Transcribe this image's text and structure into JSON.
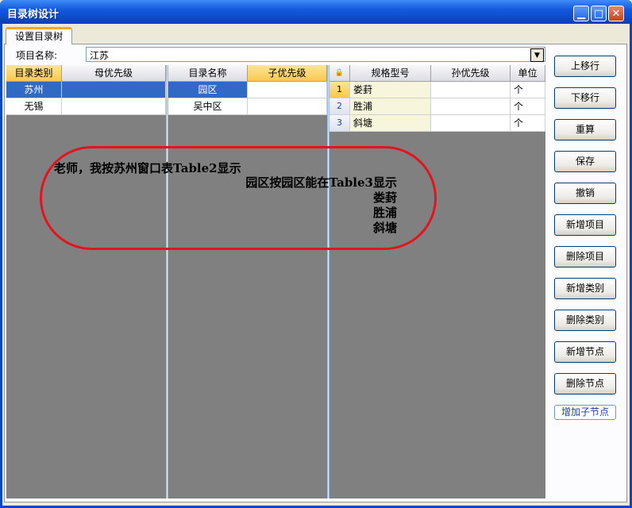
{
  "window": {
    "title": "目录树设计",
    "min": "▁",
    "max": "□",
    "close": "✕"
  },
  "tab": {
    "label": "设置目录树"
  },
  "project": {
    "label": "项目名称:",
    "value": "江苏",
    "arrow": "▼"
  },
  "table1": {
    "headers": [
      "目录类别",
      "母优先级"
    ],
    "rows": [
      {
        "name": "苏州",
        "priority": ""
      },
      {
        "name": "无锡",
        "priority": ""
      }
    ]
  },
  "table2": {
    "headers": [
      "目录名称",
      "子优先级"
    ],
    "rows": [
      {
        "name": "园区",
        "priority": ""
      },
      {
        "name": "吴中区",
        "priority": ""
      }
    ]
  },
  "table3": {
    "lock_icon": "🔒",
    "headers": [
      "规格型号",
      "孙优先级",
      "单位"
    ],
    "rows": [
      {
        "num": "1",
        "model": "娄葑",
        "priority": "",
        "unit": "个"
      },
      {
        "num": "2",
        "model": "胜浦",
        "priority": "",
        "unit": "个"
      },
      {
        "num": "3",
        "model": "斜塘",
        "priority": "",
        "unit": "个"
      }
    ]
  },
  "buttons": [
    "上移行",
    "下移行",
    "重算",
    "保存",
    "撤销",
    "新增项目",
    "删除项目",
    "新增类别",
    "删除类别",
    "新增节点",
    "删除节点"
  ],
  "link_button": "增加子节点",
  "annotation": {
    "line1": "老师，我按苏州窗口表Table2显示",
    "line2": "园区按园区能在Table3显示",
    "line3": "娄葑",
    "line4": "胜浦",
    "line5": "斜塘",
    "color": "#e3141e"
  }
}
